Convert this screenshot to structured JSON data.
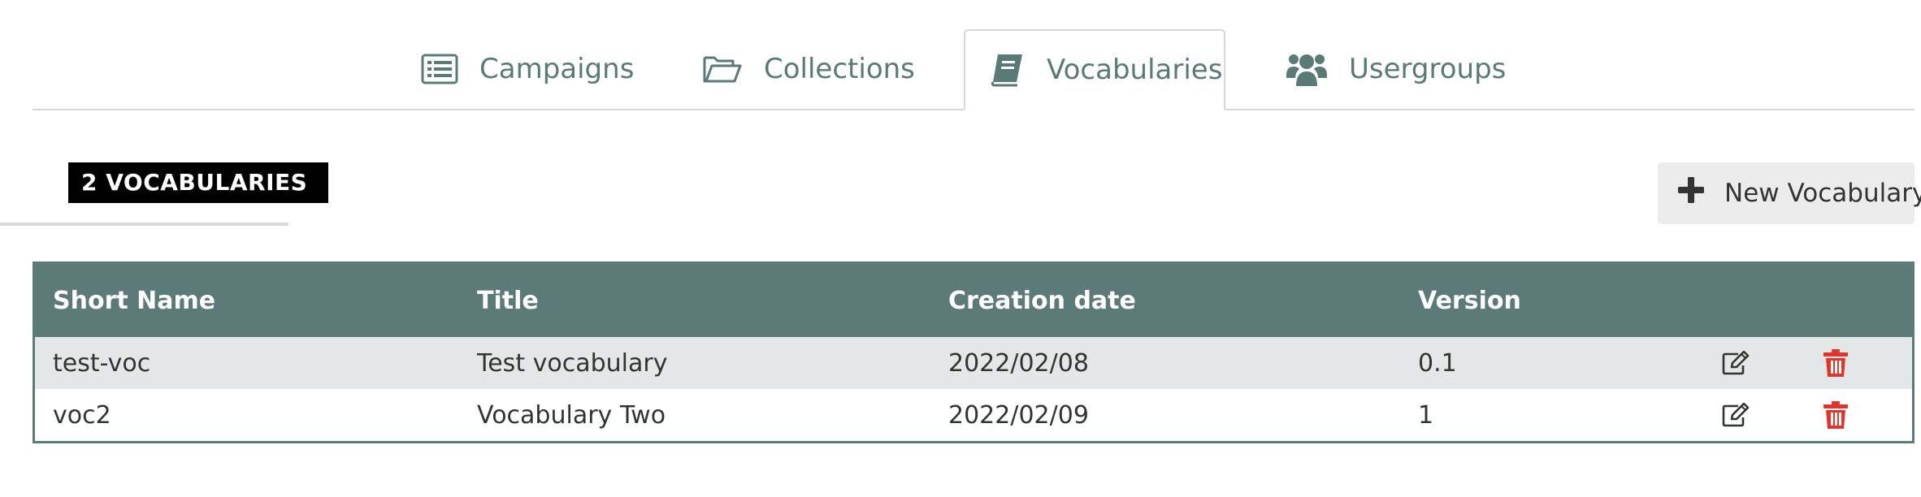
{
  "tabs": {
    "campaigns": {
      "label": "Campaigns",
      "icon": "list-icon"
    },
    "collections": {
      "label": "Collections",
      "icon": "folder-open-icon"
    },
    "vocabularies": {
      "label": "Vocabularies",
      "icon": "book-icon",
      "active": true
    },
    "usergroups": {
      "label": "Usergroups",
      "icon": "users-icon"
    }
  },
  "count_badge": "2 VOCABULARIES",
  "new_button": {
    "label": "New Vocabulary",
    "icon": "plus-icon"
  },
  "table": {
    "headers": {
      "short_name": "Short Name",
      "title": "Title",
      "creation_date": "Creation date",
      "version": "Version"
    },
    "rows": [
      {
        "short_name": "test-voc",
        "title": "Test vocabulary",
        "creation_date": "2022/02/08",
        "version": "0.1"
      },
      {
        "short_name": "voc2",
        "title": "Vocabulary Two",
        "creation_date": "2022/02/09",
        "version": "1"
      }
    ],
    "row_actions": [
      "edit-icon",
      "trash-icon"
    ]
  },
  "colors": {
    "accent": "#5b7a78",
    "tab_text": "#5a7a77",
    "delete": "#e0352b",
    "odd_row": "#e3e7e7"
  }
}
